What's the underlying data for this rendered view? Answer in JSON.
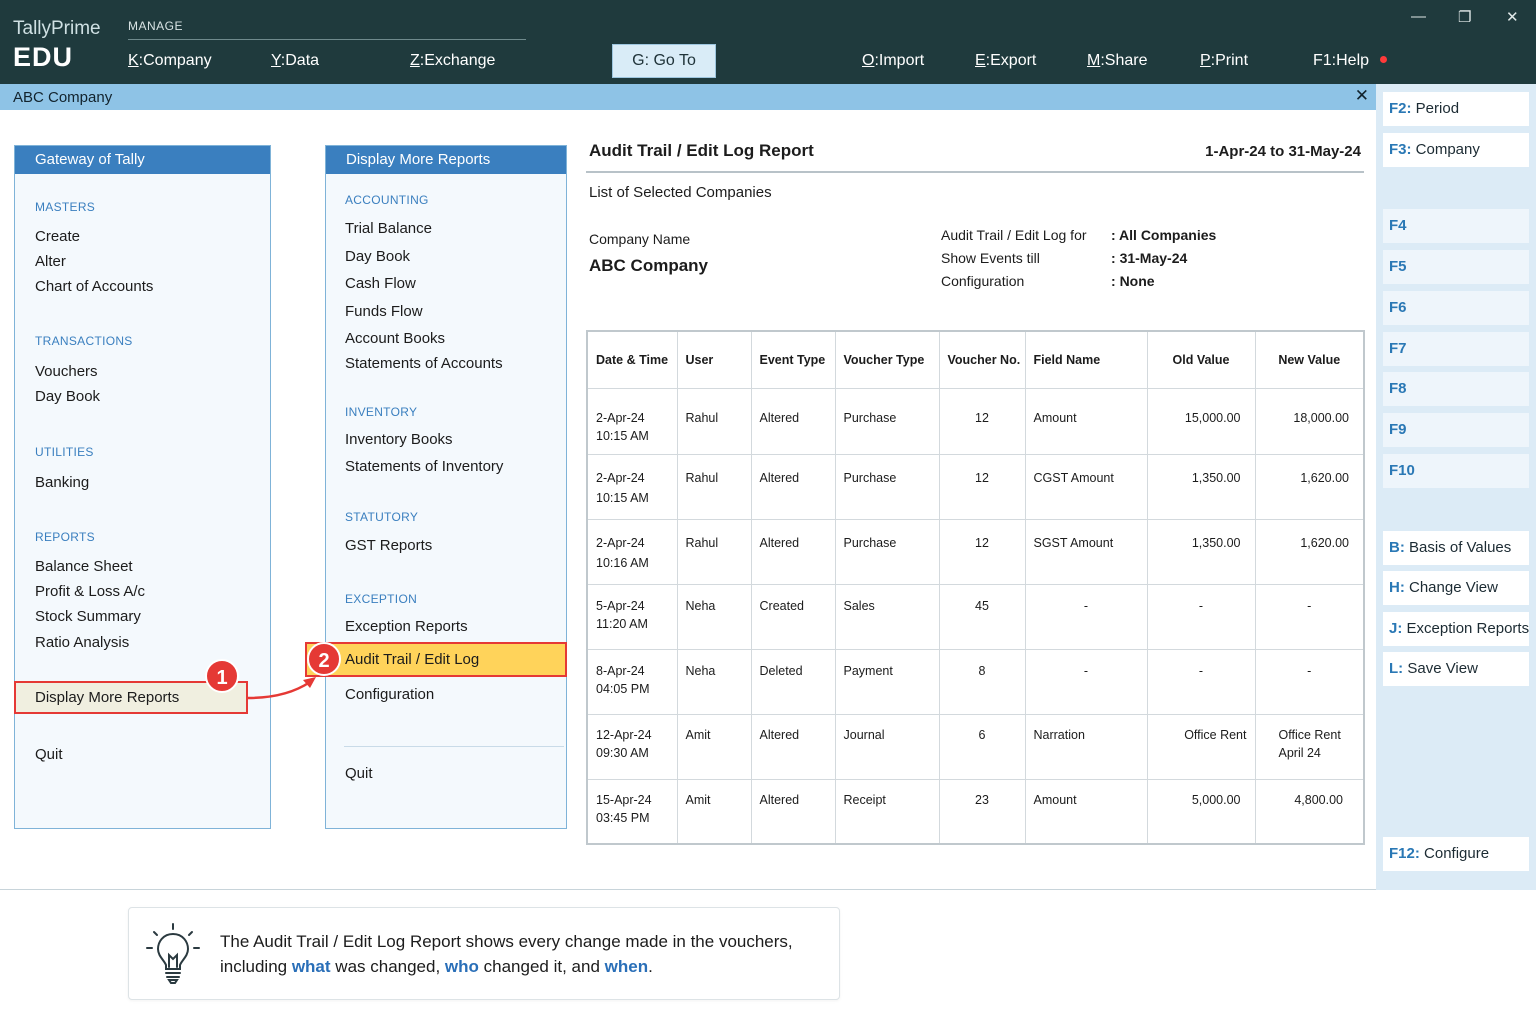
{
  "app": {
    "brand_line1": "TallyPrime",
    "brand_line2": "EDU"
  },
  "top_menu": {
    "section_label": "MANAGE",
    "items": [
      {
        "key": "K",
        "label": "Company"
      },
      {
        "key": "Y",
        "label": "Data"
      },
      {
        "key": "Z",
        "label": "Exchange"
      },
      {
        "key": "G",
        "label": "Go To"
      },
      {
        "key": "O",
        "label": "Import"
      },
      {
        "key": "E",
        "label": "Export"
      },
      {
        "key": "M",
        "label": "Share"
      },
      {
        "key": "P",
        "label": "Print"
      },
      {
        "key": "F1",
        "label": "Help"
      }
    ]
  },
  "window_controls": {
    "minimize": "—",
    "restore": "❐",
    "close": "✕"
  },
  "company_bar": {
    "name": "ABC Company",
    "close": "✕"
  },
  "gateway": {
    "title": "Gateway of Tally",
    "masters_label": "MASTERS",
    "masters": [
      "Create",
      "Alter",
      "Chart of Accounts"
    ],
    "transactions_label": "TRANSACTIONS",
    "transactions": [
      "Vouchers",
      "Day Book"
    ],
    "utilities_label": "UTILITIES",
    "utilities": [
      "Banking"
    ],
    "reports_label": "REPORTS",
    "reports": [
      "Balance Sheet",
      "Profit & Loss A/c",
      "Stock Summary",
      "Ratio Analysis"
    ],
    "display_more": "Display More Reports",
    "quit": "Quit"
  },
  "display_more": {
    "title": "Display More Reports",
    "accounting_label": "ACCOUNTING",
    "accounting": [
      "Trial Balance",
      "Day Book",
      "Cash Flow",
      "Funds Flow",
      "Account Books",
      "Statements of Accounts"
    ],
    "inventory_label": "INVENTORY",
    "inventory": [
      "Inventory Books",
      "Statements of Inventory"
    ],
    "statutory_label": "STATUTORY",
    "statutory": [
      "GST Reports"
    ],
    "exception_label": "EXCEPTION",
    "exception": [
      "Exception Reports",
      "Audit Trail / Edit Log",
      "Configuration"
    ],
    "quit": "Quit"
  },
  "badges": {
    "one": "1",
    "two": "2"
  },
  "report": {
    "title": "Audit Trail / Edit Log Report",
    "period": "1-Apr-24 to 31-May-24",
    "subtitle": "List of Selected Companies",
    "company_name_label": "Company Name",
    "company_name": "ABC Company",
    "params": [
      {
        "label": "Audit Trail / Edit Log for",
        "value": "All Companies"
      },
      {
        "label": "Show Events till",
        "value": "31-May-24"
      },
      {
        "label": "Configuration",
        "value": "None"
      }
    ],
    "columns": [
      "Date & Time",
      "User",
      "Event Type",
      "Voucher Type",
      "Voucher No.",
      "Field Name",
      "Old Value",
      "New Value"
    ],
    "rows": [
      {
        "date": "2-Apr-24",
        "time": "10:15 AM",
        "user": "Rahul",
        "event": "Altered",
        "vtype": "Purchase",
        "vno": "12",
        "field": "Amount",
        "old": "15,000.00",
        "new": "18,000.00"
      },
      {
        "date": "2-Apr-24",
        "time": "10:15 AM",
        "user": "Rahul",
        "event": "Altered",
        "vtype": "Purchase",
        "vno": "12",
        "field": "CGST Amount",
        "old": "1,350.00",
        "new": "1,620.00"
      },
      {
        "date": "2-Apr-24",
        "time": "10:16 AM",
        "user": "Rahul",
        "event": "Altered",
        "vtype": "Purchase",
        "vno": "12",
        "field": "SGST Amount",
        "old": "1,350.00",
        "new": "1,620.00"
      },
      {
        "date": "5-Apr-24",
        "time": "11:20 AM",
        "user": "Neha",
        "event": "Created",
        "vtype": "Sales",
        "vno": "45",
        "field": "-",
        "old": "-",
        "new": "-"
      },
      {
        "date": "8-Apr-24",
        "time": "04:05 PM",
        "user": "Neha",
        "event": "Deleted",
        "vtype": "Payment",
        "vno": "8",
        "field": "-",
        "old": "-",
        "new": "-"
      },
      {
        "date": "12-Apr-24",
        "time": "09:30 AM",
        "user": "Amit",
        "event": "Altered",
        "vtype": "Journal",
        "vno": "6",
        "field": "Narration",
        "old": "Office Rent",
        "new_l1": "Office Rent",
        "new_l2": "April 24"
      },
      {
        "date": "15-Apr-24",
        "time": "03:45 PM",
        "user": "Amit",
        "event": "Altered",
        "vtype": "Receipt",
        "vno": "23",
        "field": "Amount",
        "old": "5,000.00",
        "new": "4,800.00"
      }
    ]
  },
  "right_panel": [
    {
      "key": "F2:",
      "label": "Period"
    },
    {
      "key": "F3:",
      "label": "Company"
    },
    {
      "key": "F4",
      "label": ""
    },
    {
      "key": "F5",
      "label": ""
    },
    {
      "key": "F6",
      "label": ""
    },
    {
      "key": "F7",
      "label": ""
    },
    {
      "key": "F8",
      "label": ""
    },
    {
      "key": "F9",
      "label": ""
    },
    {
      "key": "F10",
      "label": ""
    },
    {
      "key": "B:",
      "label": "Basis of Values"
    },
    {
      "key": "H:",
      "label": "Change View"
    },
    {
      "key": "J:",
      "label": "Exception Reports"
    },
    {
      "key": "L:",
      "label": "Save View"
    },
    {
      "key": "F12:",
      "label": "Configure"
    }
  ],
  "tip": {
    "t1": "The Audit Trail / Edit Log Report shows every change made in the vouchers,",
    "t2": "including ",
    "w1": "what",
    "t3": " was changed, ",
    "w2": "who",
    "t4": " changed it, and ",
    "w3": "when",
    "t5": "."
  },
  "colors": {
    "topbar": "#1f3a3d",
    "accent": "#3a7fbf",
    "highlight": "#ffd35a",
    "callout": "#e53935"
  }
}
